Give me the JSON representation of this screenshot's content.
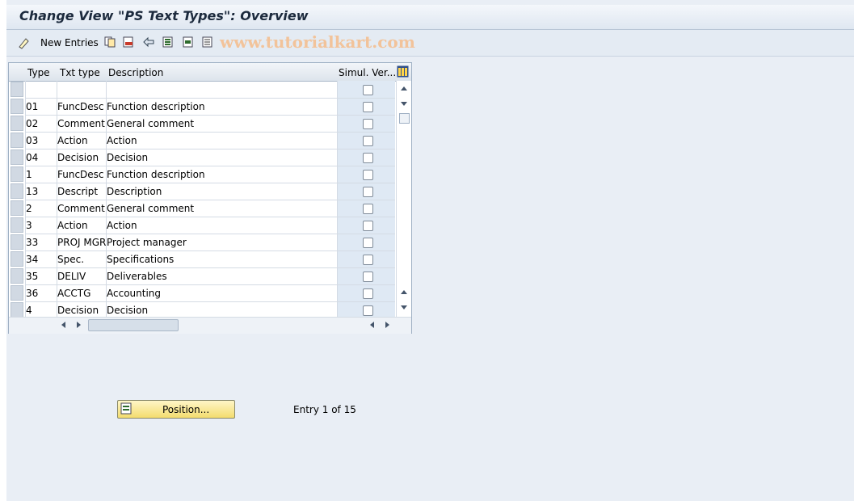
{
  "window": {
    "title": "Change View \"PS Text Types\": Overview"
  },
  "toolbar": {
    "new_entries_label": "New Entries",
    "watermark": "www.tutorialkart.com",
    "icons": [
      "change-display-icon",
      "copy-icon",
      "delete-icon",
      "undo-icon",
      "select-all-icon",
      "select-block-icon",
      "deselect-all-icon"
    ]
  },
  "table": {
    "headers": {
      "type": "Type",
      "txt_type": "Txt type",
      "description": "Description",
      "simul": "Simul. Ver..."
    },
    "rows": [
      {
        "type": "",
        "txt": "",
        "desc": "",
        "checked": false
      },
      {
        "type": "01",
        "txt": "FuncDesc",
        "desc": "Function description",
        "checked": false
      },
      {
        "type": "02",
        "txt": "Comment",
        "desc": "General comment",
        "checked": false
      },
      {
        "type": "03",
        "txt": "Action",
        "desc": "Action",
        "checked": false
      },
      {
        "type": "04",
        "txt": "Decision",
        "desc": "Decision",
        "checked": false
      },
      {
        "type": "1",
        "txt": "FuncDesc",
        "desc": "Function description",
        "checked": false
      },
      {
        "type": "13",
        "txt": "Descript",
        "desc": "Description",
        "checked": false
      },
      {
        "type": "2",
        "txt": "Comment",
        "desc": "General comment",
        "checked": false
      },
      {
        "type": "3",
        "txt": "Action",
        "desc": "Action",
        "checked": false
      },
      {
        "type": "33",
        "txt": "PROJ MGR",
        "desc": "Project manager",
        "checked": false
      },
      {
        "type": "34",
        "txt": "Spec.",
        "desc": "Specifications",
        "checked": false
      },
      {
        "type": "35",
        "txt": "DELIV",
        "desc": "Deliverables",
        "checked": false
      },
      {
        "type": "36",
        "txt": "ACCTG",
        "desc": "Accounting",
        "checked": false
      },
      {
        "type": "4",
        "txt": "Decision",
        "desc": "Decision",
        "checked": false
      }
    ]
  },
  "position_button": {
    "label": "Position..."
  },
  "entry_info": "Entry 1 of 15"
}
